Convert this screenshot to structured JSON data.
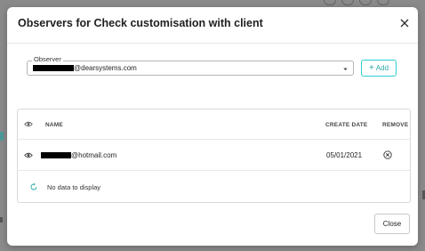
{
  "modal": {
    "title": "Observers for Check customisation with client"
  },
  "observer": {
    "label": "Observer",
    "value_suffix": "@dearsystems.com"
  },
  "add_button": {
    "label": "Add"
  },
  "table": {
    "columns": {
      "name": "NAME",
      "create_date": "CREATE DATE",
      "remove": "REMOVE"
    },
    "rows": [
      {
        "name_suffix": "@hotmail.com",
        "create_date": "05/01/2021"
      }
    ],
    "empty_text": "No data to display"
  },
  "footer": {
    "close_label": "Close"
  },
  "colors": {
    "accent": "#2aa7a7",
    "overlay": "#8a8a8a"
  }
}
